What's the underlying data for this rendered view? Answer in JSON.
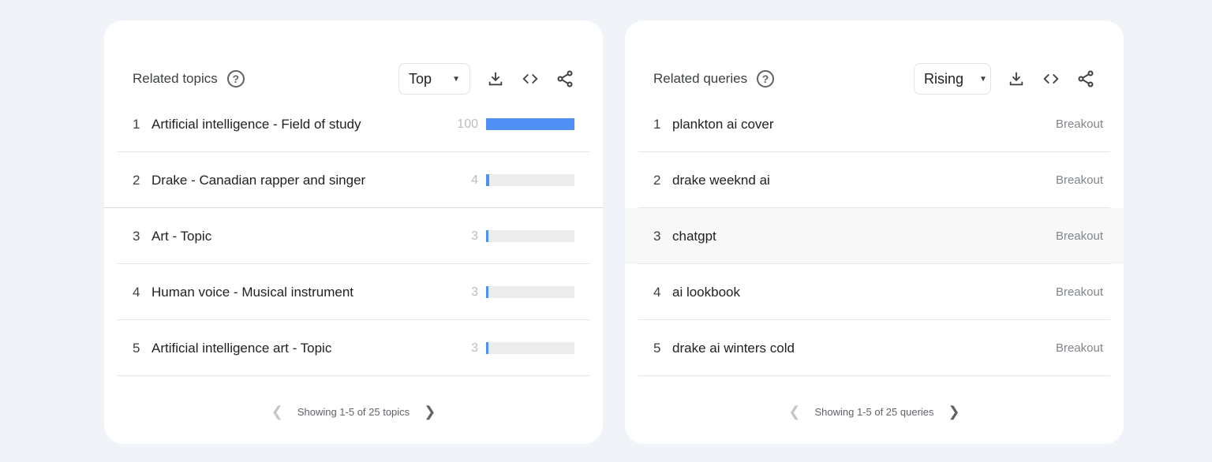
{
  "colors": {
    "bar": "#4e8ef5",
    "background": "#f0f4f9"
  },
  "topics": {
    "title": "Related topics",
    "filter": "Top",
    "icons": [
      "help-icon",
      "download-icon",
      "embed-icon",
      "share-icon"
    ],
    "items": [
      {
        "rank": "1",
        "label": "Artificial intelligence - Field of study",
        "value": 100
      },
      {
        "rank": "2",
        "label": "Drake - Canadian rapper and singer",
        "value": 4
      },
      {
        "rank": "3",
        "label": "Art - Topic",
        "value": 3
      },
      {
        "rank": "4",
        "label": "Human voice - Musical instrument",
        "value": 3
      },
      {
        "rank": "5",
        "label": "Artificial intelligence art - Topic",
        "value": 3
      }
    ],
    "footer": "Showing 1-5 of 25 topics"
  },
  "queries": {
    "title": "Related queries",
    "filter": "Rising",
    "items": [
      {
        "rank": "1",
        "label": "plankton ai cover",
        "value": "Breakout"
      },
      {
        "rank": "2",
        "label": "drake weeknd ai",
        "value": "Breakout"
      },
      {
        "rank": "3",
        "label": "chatgpt",
        "value": "Breakout"
      },
      {
        "rank": "4",
        "label": "ai lookbook",
        "value": "Breakout"
      },
      {
        "rank": "5",
        "label": "drake ai winters cold",
        "value": "Breakout"
      }
    ],
    "footer": "Showing 1-5 of 25 queries"
  }
}
